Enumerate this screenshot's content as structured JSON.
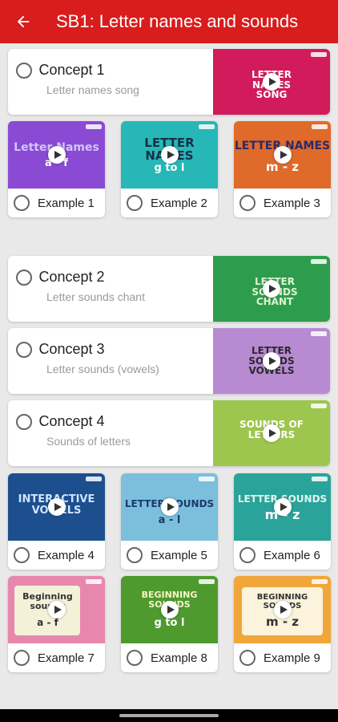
{
  "header": {
    "title": "SB1: Letter names and sounds",
    "back_icon": "arrow-left-icon"
  },
  "concepts": [
    {
      "title": "Concept 1",
      "subtitle": "Letter names song",
      "thumb_text": "LETTER NAMES SONG",
      "thumb_color": "#d11b5b"
    },
    {
      "title": "Concept 2",
      "subtitle": "Letter sounds chant",
      "thumb_text": "LETTER SOUNDS CHANT",
      "thumb_color": "#2d9d4d"
    },
    {
      "title": "Concept 3",
      "subtitle": "Letter sounds (vowels)",
      "thumb_text": "LETTER SOUNDS VOWELS",
      "thumb_color": "#b78ad1"
    },
    {
      "title": "Concept 4",
      "subtitle": "Sounds of letters",
      "thumb_text": "SOUNDS OF LETTERS",
      "thumb_color": "#9cc64e"
    }
  ],
  "examples": [
    {
      "label": "Example 1",
      "thumb_text": "Letter Names",
      "thumb_sub": "a - f",
      "thumb_color": "#8a4ad3"
    },
    {
      "label": "Example 2",
      "thumb_text": "LETTER NAMES",
      "thumb_sub": "g to l",
      "thumb_color": "#27b7b7"
    },
    {
      "label": "Example 3",
      "thumb_text": "LETTER NAMES",
      "thumb_sub": "m - z",
      "thumb_color": "#e06a2a"
    },
    {
      "label": "Example 4",
      "thumb_text": "INTERACTIVE VOWELS",
      "thumb_sub": "",
      "thumb_color": "#1d4f8f"
    },
    {
      "label": "Example 5",
      "thumb_text": "LETTER SOUNDS",
      "thumb_sub": "a - l",
      "thumb_color": "#7bbfdd"
    },
    {
      "label": "Example 6",
      "thumb_text": "LETTER SOUNDS",
      "thumb_sub": "m - z",
      "thumb_color": "#2aa39a"
    },
    {
      "label": "Example 7",
      "thumb_text": "Beginning sounds",
      "thumb_sub": "a - f",
      "thumb_color": "#e887ad"
    },
    {
      "label": "Example 8",
      "thumb_text": "BEGINNING SOUNDS",
      "thumb_sub": "g to l",
      "thumb_color": "#4f9a2e"
    },
    {
      "label": "Example 9",
      "thumb_text": "BEGINNING SOUNDS",
      "thumb_sub": "m - z",
      "thumb_color": "#f0a63a"
    }
  ],
  "colors": {
    "header_bg": "#d91c1c",
    "page_bg": "#e9e9e9"
  }
}
